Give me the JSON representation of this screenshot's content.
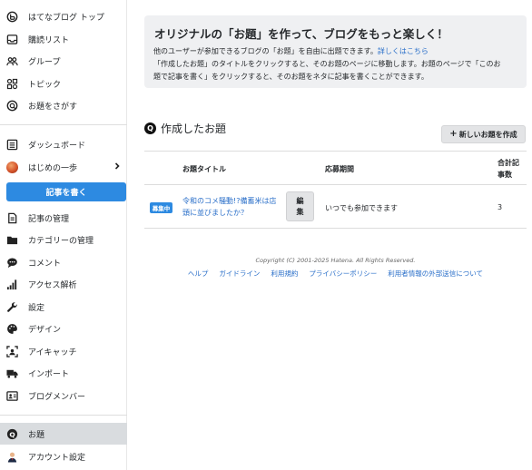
{
  "sidebar": {
    "top_items": [
      {
        "label": "はてなブログ トップ",
        "icon": "hatena-blog-icon"
      },
      {
        "label": "購読リスト",
        "icon": "inbox-icon"
      },
      {
        "label": "グループ",
        "icon": "group-icon"
      },
      {
        "label": "トピック",
        "icon": "topic-grid-icon"
      },
      {
        "label": "お題をさがす",
        "icon": "search-circle-icon"
      }
    ],
    "dashboard": "ダッシュボード",
    "blog_name": "はじめの一歩",
    "write_button": "記事を書く",
    "menu_items": [
      {
        "label": "記事の管理",
        "icon": "document-icon"
      },
      {
        "label": "カテゴリーの管理",
        "icon": "folder-icon"
      },
      {
        "label": "コメント",
        "icon": "comment-icon"
      },
      {
        "label": "アクセス解析",
        "icon": "bar-chart-icon"
      },
      {
        "label": "設定",
        "icon": "wrench-icon"
      },
      {
        "label": "デザイン",
        "icon": "palette-icon"
      },
      {
        "label": "アイキャッチ",
        "icon": "eyecatch-icon"
      },
      {
        "label": "インポート",
        "icon": "truck-icon"
      },
      {
        "label": "ブログメンバー",
        "icon": "id-card-icon"
      }
    ],
    "odai": "お題",
    "account": "アカウント設定"
  },
  "info": {
    "title": "オリジナルの「お題」を作って、ブログをもっと楽しく！",
    "line1": "他のユーザーが参加できるブログの「お題」を自由に出題できます。",
    "line1_link": "詳しくはこちら",
    "line2": "「作成したお題」のタイトルをクリックすると、そのお題のページに移動します。お題のページで「このお",
    "line3": "題で記事を書く」をクリックすると、そのお題をネタに記事を書くことができます。"
  },
  "section": {
    "badge": "Q",
    "title": "作成したお題",
    "new_button": "新しいお題を作成"
  },
  "table": {
    "headers": {
      "title": "お題タイトル",
      "period": "応募期間",
      "count_line1": "合計記",
      "count_line2": "事数"
    },
    "rows": [
      {
        "status": "募集中",
        "title": "令和のコメ騒動!?備蓄米は店頭に並びましたか？",
        "edit": "編集",
        "period": "いつでも参加できます",
        "count": "3"
      }
    ]
  },
  "footer": {
    "copyright": "Copyright (C) 2001-2025 Hatena. All Rights Reserved.",
    "links": [
      "ヘルプ",
      "ガイドライン",
      "利用規約",
      "プライバシーポリシー",
      "利用者情報の外部送信について"
    ]
  },
  "colors": {
    "accent": "#2d8ae1",
    "link": "#2a6fc9",
    "active_bg": "#d9dcdf"
  }
}
